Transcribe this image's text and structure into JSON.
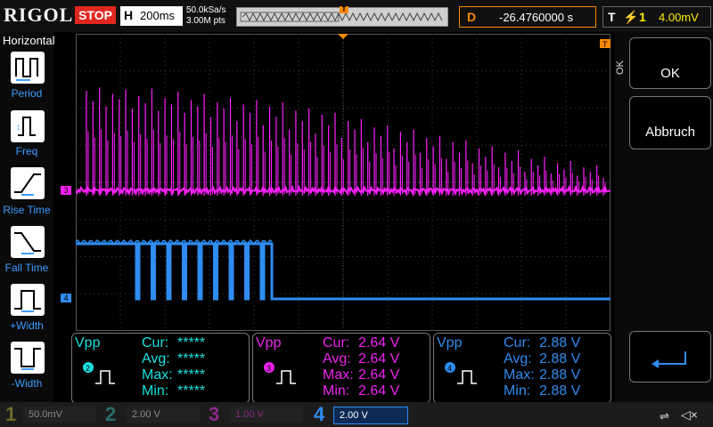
{
  "top": {
    "logo": "RIGOL",
    "run_status": "STOP",
    "timebase_letter": "H",
    "timebase_value": "200ms",
    "sample_rate": "50.0kSa/s",
    "memory_depth": "3.00M pts",
    "trigger_position_marker": "T",
    "delay_letter": "D",
    "delay_value": "-26.4760000 s",
    "trigger_letter": "T",
    "trigger_source": "1",
    "trigger_level": "4.00mV",
    "trigger_edge_icon": "rising-edge-icon"
  },
  "left_panel": {
    "title": "Horizontal",
    "buttons": [
      {
        "label": "Period",
        "icon": "period-icon"
      },
      {
        "label": "Freq",
        "icon": "frequency-icon"
      },
      {
        "label": "Rise Time",
        "icon": "rise-time-icon"
      },
      {
        "label": "Fall Time",
        "icon": "fall-time-icon"
      },
      {
        "label": "+Width",
        "icon": "positive-width-icon"
      },
      {
        "label": "-Width",
        "icon": "negative-width-icon"
      }
    ]
  },
  "right_panel": {
    "ok_vertical": "OK",
    "ok_label": "OK",
    "cancel_label": "Abbruch",
    "enter_icon": "enter-arrow-icon"
  },
  "markers": {
    "trigger_marker": "T",
    "ch3_marker": "3",
    "ch4_marker": "4"
  },
  "measurements": [
    {
      "title": "Vpp",
      "channel": "2",
      "color": "#19e0e0",
      "cur_key": "Cur:",
      "cur": "*****",
      "avg_key": "Avg:",
      "avg": "*****",
      "max_key": "Max:",
      "max": "*****",
      "min_key": "Min:",
      "min": "*****"
    },
    {
      "title": "Vpp",
      "channel": "3",
      "color": "#ee22ee",
      "cur_key": "Cur:",
      "cur": "2.64 V",
      "avg_key": "Avg:",
      "avg": "2.64 V",
      "max_key": "Max:",
      "max": "2.64 V",
      "min_key": "Min:",
      "min": "2.64 V"
    },
    {
      "title": "Vpp",
      "channel": "4",
      "color": "#2f8cf0",
      "cur_key": "Cur:",
      "cur": "2.88 V",
      "avg_key": "Avg:",
      "avg": "2.88 V",
      "max_key": "Max:",
      "max": "2.88 V",
      "min_key": "Min:",
      "min": "2.88 V"
    }
  ],
  "channels": [
    {
      "num": "1",
      "scale": "50.0mV",
      "color": "#6f6a2a"
    },
    {
      "num": "2",
      "scale": "2.00 V",
      "color": "#2a6a6a"
    },
    {
      "num": "3",
      "scale": "1.00 V",
      "color": "#8a2a8a"
    },
    {
      "num": "4",
      "scale": "2.00 V",
      "color": "#2f8cf0",
      "active": true
    }
  ],
  "colors": {
    "ch3": "#ff20ff",
    "ch4": "#2f8cf0",
    "accent": "#ff8a00",
    "stop": "#e0261e"
  },
  "traces": {
    "ch3_peaks": [
      0.95,
      0.85,
      0.98,
      0.8,
      0.92,
      0.87,
      0.96,
      0.78,
      0.9,
      0.83,
      0.97,
      0.76,
      0.88,
      0.82,
      0.94,
      0.74,
      0.86,
      0.8,
      0.92,
      0.7,
      0.84,
      0.78,
      0.88,
      0.66,
      0.82,
      0.74,
      0.86,
      0.62,
      0.8,
      0.7,
      0.84,
      0.58,
      0.76,
      0.66,
      0.78,
      0.54,
      0.72,
      0.62,
      0.74,
      0.5,
      0.66,
      0.58,
      0.68,
      0.46,
      0.6,
      0.52,
      0.62,
      0.4,
      0.56,
      0.46,
      0.58,
      0.36,
      0.5,
      0.42,
      0.52,
      0.3,
      0.46,
      0.36,
      0.48,
      0.26,
      0.4,
      0.32,
      0.42,
      0.22,
      0.36,
      0.28,
      0.38,
      0.18,
      0.3,
      0.24,
      0.32,
      0.16,
      0.26,
      0.2,
      0.28,
      0.14,
      0.22,
      0.18,
      0.24,
      0.12
    ],
    "ch4_pulses": 9
  },
  "bottom": {
    "usb_icon": "usb-icon",
    "mute_icon": "mute-icon"
  }
}
